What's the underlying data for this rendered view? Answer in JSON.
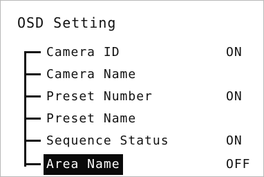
{
  "title": "OSD Setting",
  "items": [
    {
      "label": "Camera ID",
      "value": "ON"
    },
    {
      "label": "Camera Name",
      "value": ""
    },
    {
      "label": "Preset Number",
      "value": "ON"
    },
    {
      "label": "Preset Name",
      "value": ""
    },
    {
      "label": "Sequence Status",
      "value": "ON"
    },
    {
      "label": "Area Name",
      "value": "OFF",
      "selected": true
    }
  ],
  "colors": {
    "text": "#111111",
    "highlight_bg": "#0a0a0a",
    "highlight_text": "#ffffff"
  }
}
